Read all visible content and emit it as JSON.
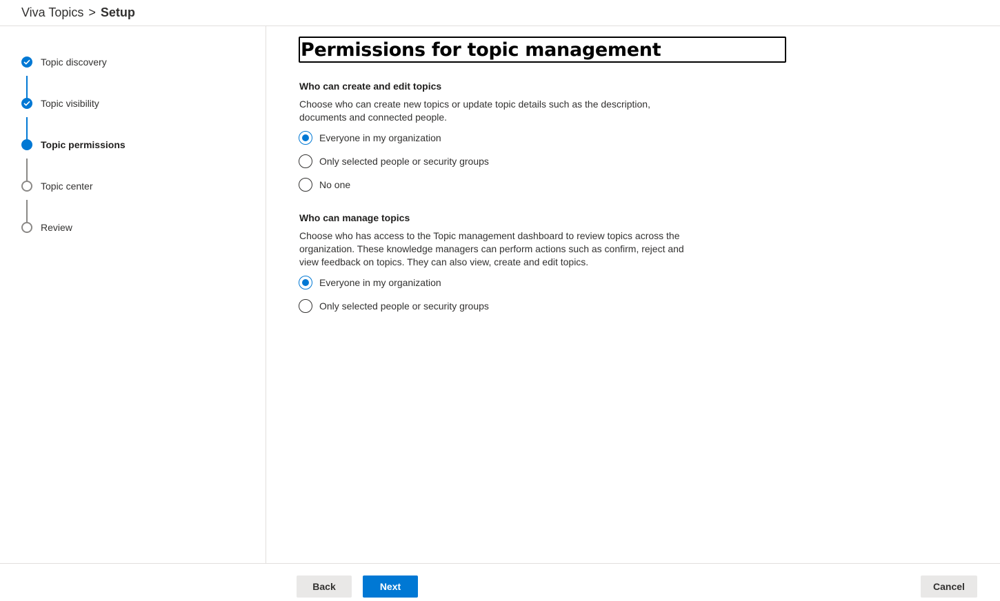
{
  "breadcrumb": {
    "app": "Viva Topics",
    "separator": ">",
    "current": "Setup"
  },
  "steps": [
    {
      "label": "Topic discovery",
      "status": "done"
    },
    {
      "label": "Topic visibility",
      "status": "done"
    },
    {
      "label": "Topic permissions",
      "status": "current"
    },
    {
      "label": "Topic center",
      "status": "todo"
    },
    {
      "label": "Review",
      "status": "todo"
    }
  ],
  "main": {
    "title": "Permissions for topic management",
    "create_section": {
      "heading": "Who can create and edit topics",
      "description": "Choose who can create new topics or update topic details such as the description, documents and connected people.",
      "options": [
        {
          "label": "Everyone in my organization",
          "checked": true
        },
        {
          "label": "Only selected people or security groups",
          "checked": false
        },
        {
          "label": "No one",
          "checked": false
        }
      ]
    },
    "manage_section": {
      "heading": "Who can manage topics",
      "description": "Choose who has access to the Topic management dashboard to review topics across the organization. These knowledge managers can perform actions such as confirm, reject and view feedback on topics. They can also view, create and edit topics.",
      "options": [
        {
          "label": "Everyone in my organization",
          "checked": true
        },
        {
          "label": "Only selected people or security groups",
          "checked": false
        }
      ]
    }
  },
  "footer": {
    "back_label": "Back",
    "next_label": "Next",
    "cancel_label": "Cancel"
  },
  "colors": {
    "accent": "#0078d4",
    "pending": "#8a8886"
  },
  "icons": {
    "done_step": "checkmark-icon",
    "current_step": "filled-circle-icon",
    "todo_step": "empty-circle-icon"
  }
}
